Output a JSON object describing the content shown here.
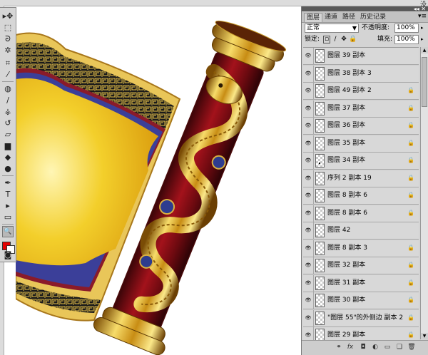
{
  "ruler": {
    "right_label": "没"
  },
  "toolbox": {
    "tools": [
      {
        "name": "move-tool-icon",
        "glyph": "▸✥"
      },
      {
        "name": "marquee-tool-icon",
        "glyph": "⬚"
      },
      {
        "name": "lasso-tool-icon",
        "glyph": "ᘐ"
      },
      {
        "name": "magic-wand-tool-icon",
        "glyph": "✲"
      },
      {
        "name": "crop-tool-icon",
        "glyph": "⌗"
      },
      {
        "name": "eyedropper-tool-icon",
        "glyph": "⁄"
      },
      {
        "name": "healing-brush-tool-icon",
        "glyph": "◍"
      },
      {
        "name": "brush-tool-icon",
        "glyph": "∕"
      },
      {
        "name": "clone-stamp-tool-icon",
        "glyph": "⚶"
      },
      {
        "name": "history-brush-tool-icon",
        "glyph": "↺"
      },
      {
        "name": "eraser-tool-icon",
        "glyph": "▱"
      },
      {
        "name": "gradient-tool-icon",
        "glyph": "▆"
      },
      {
        "name": "blur-tool-icon",
        "glyph": "◆"
      },
      {
        "name": "dodge-tool-icon",
        "glyph": "●"
      },
      {
        "name": "pen-tool-icon",
        "glyph": "✒"
      },
      {
        "name": "type-tool-icon",
        "glyph": "T"
      },
      {
        "name": "path-selection-tool-icon",
        "glyph": "▸"
      },
      {
        "name": "shape-tool-icon",
        "glyph": "▭"
      },
      {
        "name": "hand-tool-icon",
        "glyph": "✋"
      },
      {
        "name": "zoom-tool-icon",
        "glyph": "🔍"
      }
    ],
    "foreground_color": "#e60000",
    "background_color": "#ffffff",
    "quick_mask_glyph": "◙"
  },
  "panel": {
    "titlebar_controls": "◂◂ ✕",
    "tabs": [
      "图层",
      "通道",
      "路径",
      "历史记录"
    ],
    "tab_menu_glyph": "▾≡",
    "blend_mode": "正常",
    "opacity_label": "不透明度:",
    "opacity_value": "100%",
    "lock_label": "锁定:",
    "fill_label": "填充:",
    "fill_value": "100%",
    "layers": [
      {
        "name": "图层 39 副本",
        "locked": false
      },
      {
        "name": "图层 38 副本 3",
        "locked": false
      },
      {
        "name": "图层 49 副本 2",
        "locked": true
      },
      {
        "name": "图层 37 副本",
        "locked": true
      },
      {
        "name": "图层 36 副本",
        "locked": true
      },
      {
        "name": "图层 35 副本",
        "locked": true
      },
      {
        "name": "图层 34 副本",
        "locked": true
      },
      {
        "name": "序列 2 副本 19",
        "locked": true
      },
      {
        "name": "图层 8 副本 6",
        "locked": true
      },
      {
        "name": "图层 8 副本 6",
        "locked": true
      },
      {
        "name": "图层 42",
        "locked": false
      },
      {
        "name": "图层 8 副本 3",
        "locked": true
      },
      {
        "name": "图层 32 副本",
        "locked": true
      },
      {
        "name": "图层 31 副本",
        "locked": true
      },
      {
        "name": "图层 30 副本",
        "locked": true
      },
      {
        "name": "\"图层 55\"的外侧边 副本 2",
        "locked": true
      },
      {
        "name": "图层 29 副本",
        "locked": true
      }
    ],
    "footer_buttons": [
      "link-layers",
      "fx",
      "mask",
      "adjustment",
      "group",
      "new-layer",
      "delete"
    ]
  }
}
